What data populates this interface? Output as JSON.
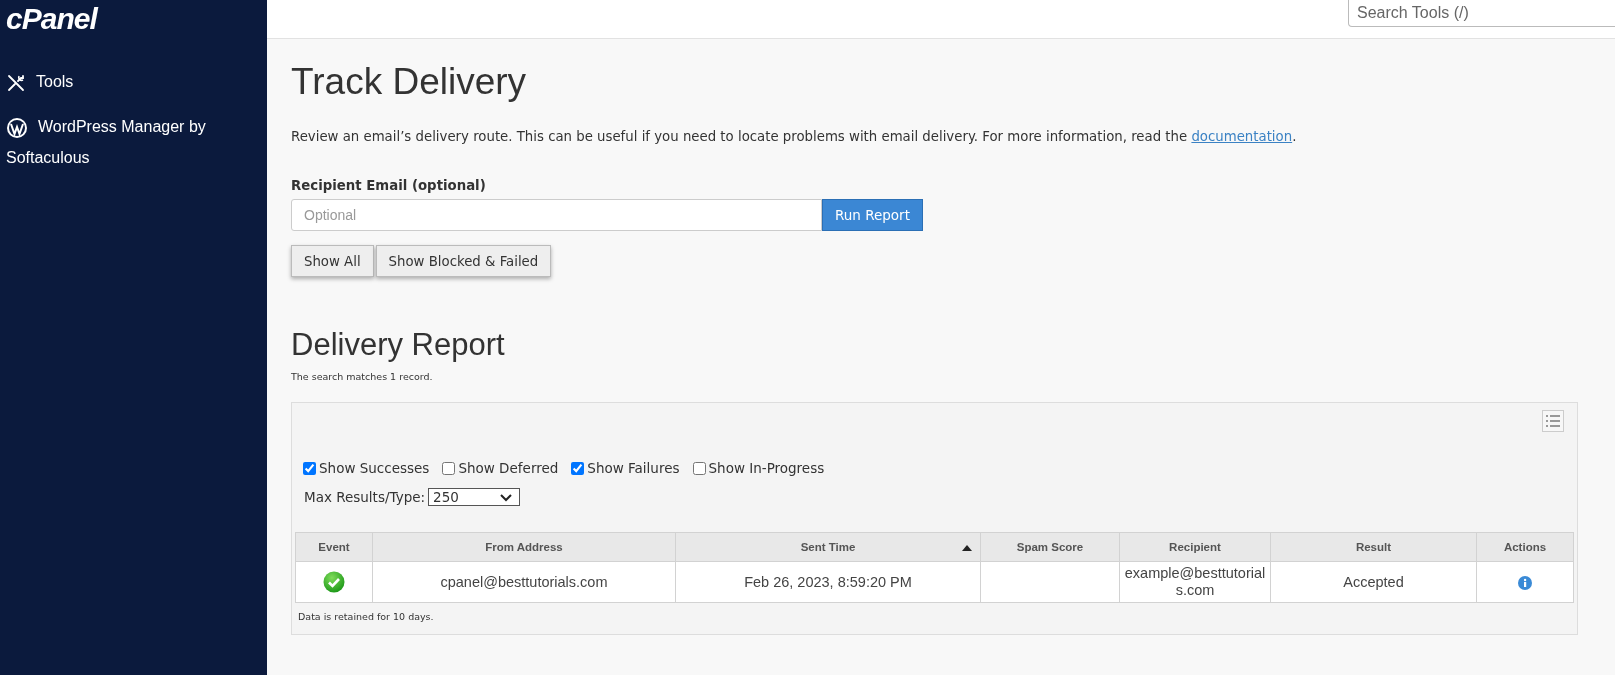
{
  "sidebar": {
    "logo": "cPanel",
    "items": [
      {
        "label": "Tools",
        "kind": "tools"
      },
      {
        "label": "WordPress Manager by Softaculous",
        "kind": "wordpress"
      }
    ]
  },
  "header": {
    "search": {
      "placeholder": "Search Tools (/)"
    }
  },
  "page": {
    "title": "Track Delivery",
    "intro": "Review an email’s delivery route. This can be useful if you need to locate problems with email delivery. For more information, read the ",
    "intro_link": "documentation",
    "intro_end": ".",
    "recipient_label": "Recipient Email (optional)",
    "recipient_placeholder": "Optional",
    "run_button": "Run Report",
    "filter_buttons": [
      "Show All",
      "Show Blocked & Failed"
    ]
  },
  "report": {
    "title": "Delivery Report",
    "summary": "The search matches 1 record.",
    "filters": [
      {
        "label": "Show Successes",
        "checked": true
      },
      {
        "label": "Show Deferred",
        "checked": false
      },
      {
        "label": "Show Failures",
        "checked": true
      },
      {
        "label": "Show In-Progress",
        "checked": false
      }
    ],
    "max_results_label": "Max Results/Type:",
    "max_results": "250",
    "table": {
      "columns": [
        {
          "label": "Event",
          "sorted": false
        },
        {
          "label": "From Address",
          "sorted": false
        },
        {
          "label": "Sent Time",
          "sorted": true
        },
        {
          "label": "Spam Score",
          "sorted": false
        },
        {
          "label": "Recipient",
          "sorted": false
        },
        {
          "label": "Result",
          "sorted": false
        },
        {
          "label": "Actions",
          "sorted": false
        }
      ],
      "rows": [
        {
          "kind": "success",
          "from": "cpanel@besttutorials.com",
          "sent": "Feb 26, 2023, 8:59:20 PM",
          "recipient": "example@besttutorials.com",
          "result": "Accepted"
        }
      ]
    },
    "footnote": "Data is retained for 10 days."
  }
}
